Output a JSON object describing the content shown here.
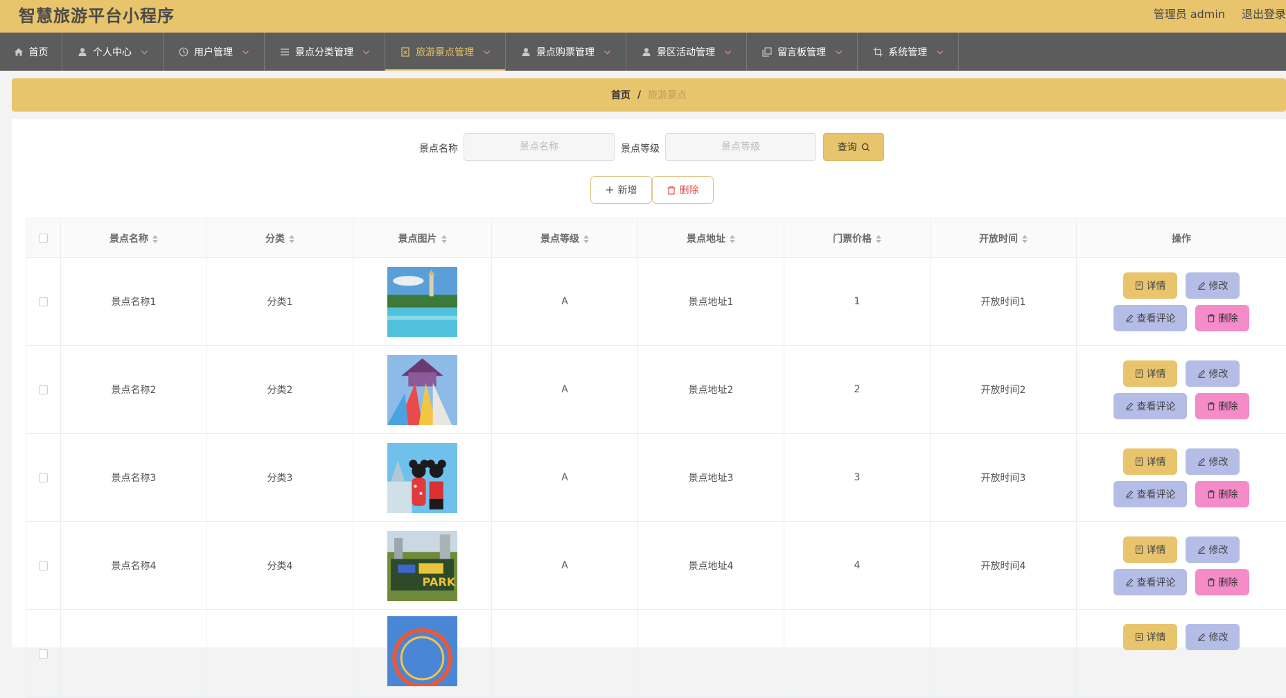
{
  "header": {
    "title": "智慧旅游平台小程序",
    "user": "管理员 admin",
    "logout": "退出登录"
  },
  "nav": [
    {
      "label": "首页",
      "icon": "home-icon",
      "caret": false,
      "active": false
    },
    {
      "label": "个人中心",
      "icon": "person-icon",
      "caret": true,
      "active": false
    },
    {
      "label": "用户管理",
      "icon": "clock-icon",
      "caret": true,
      "active": false
    },
    {
      "label": "景点分类管理",
      "icon": "list-icon",
      "caret": true,
      "active": false
    },
    {
      "label": "旅游景点管理",
      "icon": "document-icon",
      "caret": true,
      "active": true
    },
    {
      "label": "景点购票管理",
      "icon": "person-icon",
      "caret": true,
      "active": false
    },
    {
      "label": "景区活动管理",
      "icon": "person-icon",
      "caret": true,
      "active": false
    },
    {
      "label": "留言板管理",
      "icon": "copy-icon",
      "caret": true,
      "active": false
    },
    {
      "label": "系统管理",
      "icon": "crop-icon",
      "caret": true,
      "active": false
    }
  ],
  "breadcrumb": {
    "home": "首页",
    "sep": "/",
    "current": "旅游景点"
  },
  "search": {
    "name_label": "景点名称",
    "name_placeholder": "景点名称",
    "level_label": "景点等级",
    "level_placeholder": "景点等级",
    "query_button": "查询"
  },
  "actions": {
    "add": "新增",
    "delete": "删除"
  },
  "table": {
    "columns": [
      "景点名称",
      "分类",
      "景点图片",
      "景点等级",
      "景点地址",
      "门票价格",
      "开放时间",
      "操作"
    ],
    "rows": [
      {
        "name": "景点名称1",
        "category": "分类1",
        "level": "A",
        "address": "景点地址1",
        "price": "1",
        "open": "开放时间1",
        "image": "lake-tower"
      },
      {
        "name": "景点名称2",
        "category": "分类2",
        "level": "A",
        "address": "景点地址2",
        "price": "2",
        "open": "开放时间2",
        "image": "water-park"
      },
      {
        "name": "景点名称3",
        "category": "分类3",
        "level": "A",
        "address": "景点地址3",
        "price": "3",
        "open": "开放时间3",
        "image": "mickey-minnie"
      },
      {
        "name": "景点名称4",
        "category": "分类4",
        "level": "A",
        "address": "景点地址4",
        "price": "4",
        "open": "开放时间4",
        "image": "park-sign"
      },
      {
        "name": "",
        "category": "",
        "level": "",
        "address": "",
        "price": "",
        "open": "",
        "image": "ferris-wheel"
      }
    ],
    "row_buttons": {
      "detail": "详情",
      "edit": "修改",
      "review": "查看评论",
      "delete": "删除"
    }
  },
  "colors": {
    "accent": "#e8c46d",
    "nav_bg": "#5c5c5c",
    "edit_btn": "#b4bde6",
    "delete_btn": "#f58bc9"
  }
}
